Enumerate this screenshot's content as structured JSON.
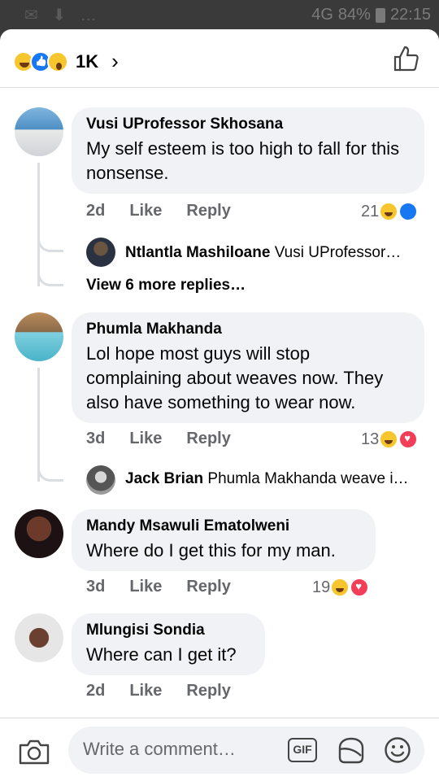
{
  "status_bar": {
    "icons_left": "✉ ⬇ …",
    "signal": "4G",
    "battery": "84%",
    "time": "22:15"
  },
  "header": {
    "reaction_icons": [
      "haha-icon",
      "like-icon",
      "wow-icon"
    ],
    "reaction_count": "1K"
  },
  "comments": [
    {
      "author": "Vusi UProfessor Skhosana",
      "text": "My self esteem is too high to fall for this nonsense.",
      "time": "2d",
      "like": "Like",
      "reply": "Reply",
      "reaction_count": "21",
      "reactions": [
        "haha",
        "like"
      ],
      "reply_preview": {
        "author": "Ntlantla Mashiloane",
        "text": "Vusi UProfessor…"
      },
      "view_more": "View 6 more replies…"
    },
    {
      "author": "Phumla Makhanda",
      "text": "Lol hope most guys will stop complaining about weaves now. They also have something to wear now.",
      "time": "3d",
      "like": "Like",
      "reply": "Reply",
      "reaction_count": "13",
      "reactions": [
        "haha",
        "love"
      ],
      "reply_preview": {
        "author": "Jack Brian",
        "text": "Phumla Makhanda weave i…"
      }
    },
    {
      "author": "Mandy Msawuli Ematolweni",
      "text": "Where do I get this for my man.",
      "time": "3d",
      "like": "Like",
      "reply": "Reply",
      "reaction_count": "19",
      "reactions": [
        "haha",
        "love"
      ]
    },
    {
      "author": "Mlungisi Sondia",
      "text": "Where can I get it?",
      "time": "2d",
      "like": "Like",
      "reply": "Reply"
    }
  ],
  "composer": {
    "placeholder": "Write a comment…",
    "gif_label": "GIF"
  },
  "colors": {
    "accent_blue": "#1877f2",
    "love_red": "#f33e58",
    "haha_yellow": "#f7c62e",
    "bubble_bg": "#f0f2f5",
    "meta_gray": "#65676b"
  }
}
